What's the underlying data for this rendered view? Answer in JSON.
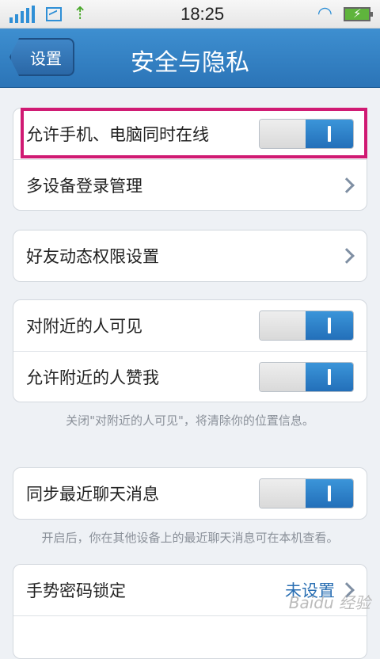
{
  "status_bar": {
    "time": "18:25",
    "icons": [
      "signal-icon",
      "image-icon",
      "usb-icon",
      "wifi-icon",
      "battery-charging-icon"
    ]
  },
  "header": {
    "back_label": "设置",
    "title": "安全与隐私"
  },
  "group1": {
    "row1_label": "允许手机、电脑同时在线",
    "row1_toggle": "on",
    "row2_label": "多设备登录管理"
  },
  "group2": {
    "row1_label": "好友动态权限设置"
  },
  "group3": {
    "row1_label": "对附近的人可见",
    "row1_toggle": "on",
    "row2_label": "允许附近的人赞我",
    "row2_toggle": "on",
    "note": "关闭\"对附近的人可见\"，将清除你的位置信息。"
  },
  "group4": {
    "row1_label": "同步最近聊天消息",
    "row1_toggle": "on",
    "note": "开启后，你在其他设备上的最近聊天消息可在本机查看。"
  },
  "group5": {
    "row1_label": "手势密码锁定",
    "row1_value": "未设置"
  },
  "watermark": "Baidu 经验",
  "colors": {
    "header": "#2b74b7",
    "toggle_on": "#236fb9",
    "highlight": "#d01a73",
    "value_text": "#2a6fb3"
  }
}
